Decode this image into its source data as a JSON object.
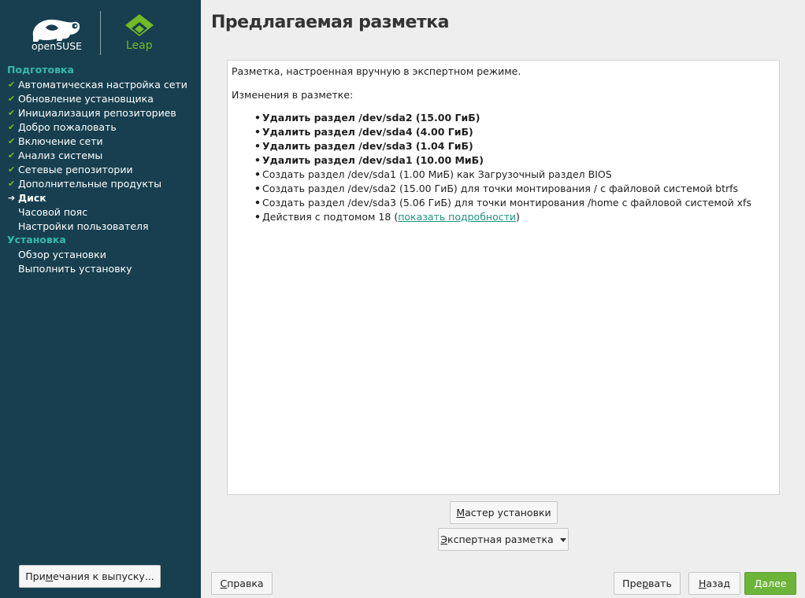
{
  "sidebar": {
    "brand": {
      "opensuse_text": "openSUSE",
      "leap_text": "Leap"
    },
    "sections": [
      {
        "title": "Подготовка",
        "steps": [
          {
            "label": "Автоматическая настройка сети",
            "status": "done"
          },
          {
            "label": "Обновление установщика",
            "status": "done"
          },
          {
            "label": "Инициализация репозиториев",
            "status": "done"
          },
          {
            "label": "Добро пожаловать",
            "status": "done"
          },
          {
            "label": "Включение сети",
            "status": "done"
          },
          {
            "label": "Анализ системы",
            "status": "done"
          },
          {
            "label": "Сетевые репозитории",
            "status": "done"
          },
          {
            "label": "Дополнительные продукты",
            "status": "done"
          },
          {
            "label": "Диск",
            "status": "current"
          },
          {
            "label": "Часовой пояс",
            "status": "pending"
          },
          {
            "label": "Настройки пользователя",
            "status": "pending"
          }
        ]
      },
      {
        "title": "Установка",
        "steps": [
          {
            "label": "Обзор установки",
            "status": "pending"
          },
          {
            "label": "Выполнить установку",
            "status": "pending"
          }
        ]
      }
    ],
    "release_notes_button": {
      "pre": "При",
      "u": "м",
      "post": "ечания к выпуску..."
    }
  },
  "page_title": "Предлагаемая разметка",
  "content": {
    "intro": "Разметка, настроенная вручную в экспертном режиме.",
    "changes_header": "Изменения в разметке:",
    "changes": [
      {
        "text": "Удалить раздел /dev/sda2 (15.00 ГиБ)",
        "kind": "delete"
      },
      {
        "text": "Удалить раздел /dev/sda4 (4.00 ГиБ)",
        "kind": "delete"
      },
      {
        "text": "Удалить раздел /dev/sda3 (1.04 ГиБ)",
        "kind": "delete"
      },
      {
        "text": "Удалить раздел /dev/sda1 (10.00 МиБ)",
        "kind": "delete"
      },
      {
        "text": "Создать раздел /dev/sda1 (1.00 МиБ) как Загрузочный раздел BIOS",
        "kind": "create"
      },
      {
        "text": "Создать раздел /dev/sda2 (15.00 ГиБ) для точки монтирования / с файловой системой btrfs",
        "kind": "create"
      },
      {
        "text": "Создать раздел /dev/sda3 (5.06 ГиБ) для точки монтирования /home с файловой системой xfs",
        "kind": "create"
      }
    ],
    "subvolumes": {
      "pre": "Действия с подтомом 18 (",
      "link": "показать подробности",
      "post": ")"
    }
  },
  "buttons": {
    "guided": {
      "u": "М",
      "rest": "астер установки"
    },
    "expert": {
      "u": "Э",
      "rest": "кспертная разметка"
    },
    "help": {
      "u": "С",
      "rest": "правка"
    },
    "abort": {
      "pre": "Пре",
      "u": "р",
      "post": "вать"
    },
    "back": {
      "u": "Н",
      "rest": "азад"
    },
    "next": {
      "u": "Д",
      "rest": "алее"
    }
  },
  "colors": {
    "sidebar_bg": "#173f4f",
    "accent_green": "#73ba25",
    "section_teal": "#35b9ab",
    "link": "#1c9680"
  }
}
